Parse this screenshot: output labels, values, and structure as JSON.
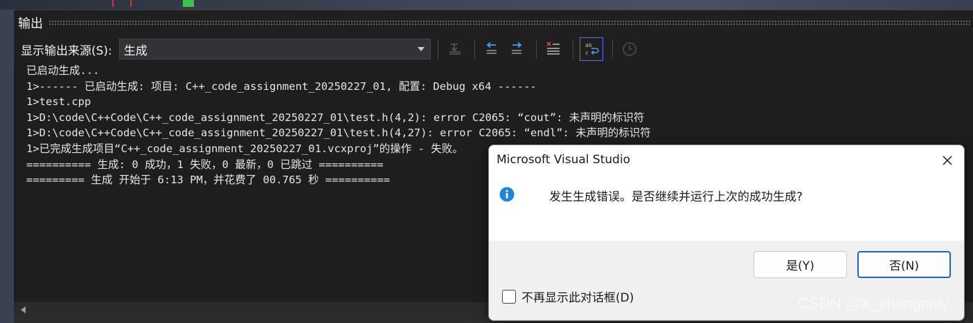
{
  "panel": {
    "title": "输出",
    "source_label": "显示输出来源(S):",
    "source_value": "生成",
    "toolbar_icons": [
      "go-to-location-icon",
      "previous-message-icon",
      "next-message-icon",
      "clear-all-icon",
      "toggle-word-wrap-icon",
      "clock-icon"
    ]
  },
  "output": {
    "lines": [
      "已启动生成...",
      "1>------ 已启动生成: 项目: C++_code_assignment_20250227_01, 配置: Debug x64 ------",
      "1>test.cpp",
      "1>D:\\code\\C++Code\\C++_code_assignment_20250227_01\\test.h(4,2): error C2065: “cout”: 未声明的标识符",
      "1>D:\\code\\C++Code\\C++_code_assignment_20250227_01\\test.h(4,27): error C2065: “endl”: 未声明的标识符",
      "1>已完成生成项目“C++_code_assignment_20250227_01.vcxproj”的操作 - 失败。",
      "========== 生成: 0 成功，1 失败，0 最新，0 已跳过 ==========",
      "========= 生成 开始于 6:13 PM，并花费了 00.765 秒 =========="
    ]
  },
  "dialog": {
    "title": "Microsoft Visual Studio",
    "message": "发生生成错误。是否继续并运行上次的成功生成?",
    "yes_label": "是(Y)",
    "no_label": "否(N)",
    "checkbox_label": "不再显示此对话框(D)",
    "checkbox_checked": false
  },
  "watermark": "CSDN @X_chengonly",
  "colors": {
    "panel_bg": "#1f1f1f",
    "accent": "#6e6bf0",
    "info_blue": "#1e88d6",
    "default_button_border": "#1f5fbf"
  }
}
